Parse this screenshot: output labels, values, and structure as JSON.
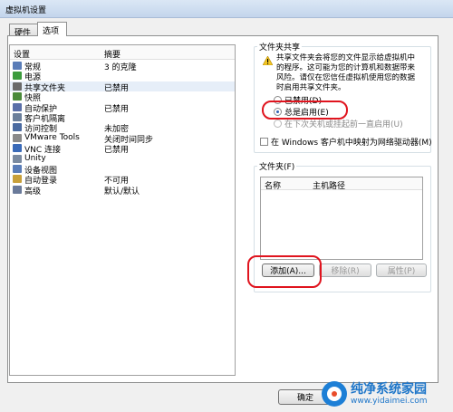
{
  "window": {
    "title": "虚拟机设置"
  },
  "tabs": [
    {
      "label": "硬件"
    },
    {
      "label": "选项"
    }
  ],
  "settings_list": {
    "headers": {
      "setting": "设置",
      "summary": "摘要"
    },
    "rows": [
      {
        "name": "常规",
        "summary": "3 的克隆",
        "icon": "general-icon",
        "color": "#5a7db8"
      },
      {
        "name": "电源",
        "summary": "",
        "icon": "power-icon",
        "color": "#3c9b3c"
      },
      {
        "name": "共享文件夹",
        "summary": "已禁用",
        "icon": "shared-folder-icon",
        "color": "#6a6a6a"
      },
      {
        "name": "快照",
        "summary": "",
        "icon": "snapshot-icon",
        "color": "#4a8a3a"
      },
      {
        "name": "自动保护",
        "summary": "已禁用",
        "icon": "autoprotect-icon",
        "color": "#5a6fa8"
      },
      {
        "name": "客户机隔离",
        "summary": "",
        "icon": "isolation-icon",
        "color": "#6b7f9b"
      },
      {
        "name": "访问控制",
        "summary": "未加密",
        "icon": "access-control-icon",
        "color": "#4a6aa0"
      },
      {
        "name": "VMware Tools",
        "summary": "关闭时间同步",
        "icon": "vmware-tools-icon",
        "color": "#8a8a8a"
      },
      {
        "name": "VNC 连接",
        "summary": "已禁用",
        "icon": "vnc-icon",
        "color": "#3a6ab8"
      },
      {
        "name": "Unity",
        "summary": "",
        "icon": "unity-icon",
        "color": "#7a8aa0"
      },
      {
        "name": "设备视图",
        "summary": "",
        "icon": "device-view-icon",
        "color": "#5a7db8"
      },
      {
        "name": "自动登录",
        "summary": "不可用",
        "icon": "autologin-icon",
        "color": "#c8a03a"
      },
      {
        "name": "高级",
        "summary": "默认/默认",
        "icon": "advanced-icon",
        "color": "#6a7a9a"
      }
    ]
  },
  "sharing": {
    "group_label": "文件夹共享",
    "warning_lines": [
      "共享文件夹会将您的文件显示给虚拟机中",
      "的程序。这可能为您的计算机和数据带来",
      "风险。请仅在您信任虚拟机使用您的数据",
      "时启用共享文件夹。"
    ],
    "options": [
      {
        "label": "已禁用(D)",
        "selected": false
      },
      {
        "label": "总是启用(E)",
        "selected": true
      },
      {
        "label": "在下次关机或挂起前一直启用(U)",
        "selected": false
      }
    ],
    "map_drive_label": "在 Windows 客户机中映射为网络驱动器(M)",
    "map_drive_checked": false
  },
  "folders": {
    "group_label": "文件夹(F)",
    "headers": {
      "name": "名称",
      "path": "主机路径"
    },
    "buttons": {
      "add": "添加(A)...",
      "remove": "移除(R)",
      "properties": "属性(P)"
    }
  },
  "footer": {
    "ok": "确定"
  },
  "watermark": {
    "title": "纯净系统家园",
    "url": "www.yidaimei.com"
  },
  "colors": {
    "annotation": "#e0141e",
    "accent": "#1e76c9"
  }
}
